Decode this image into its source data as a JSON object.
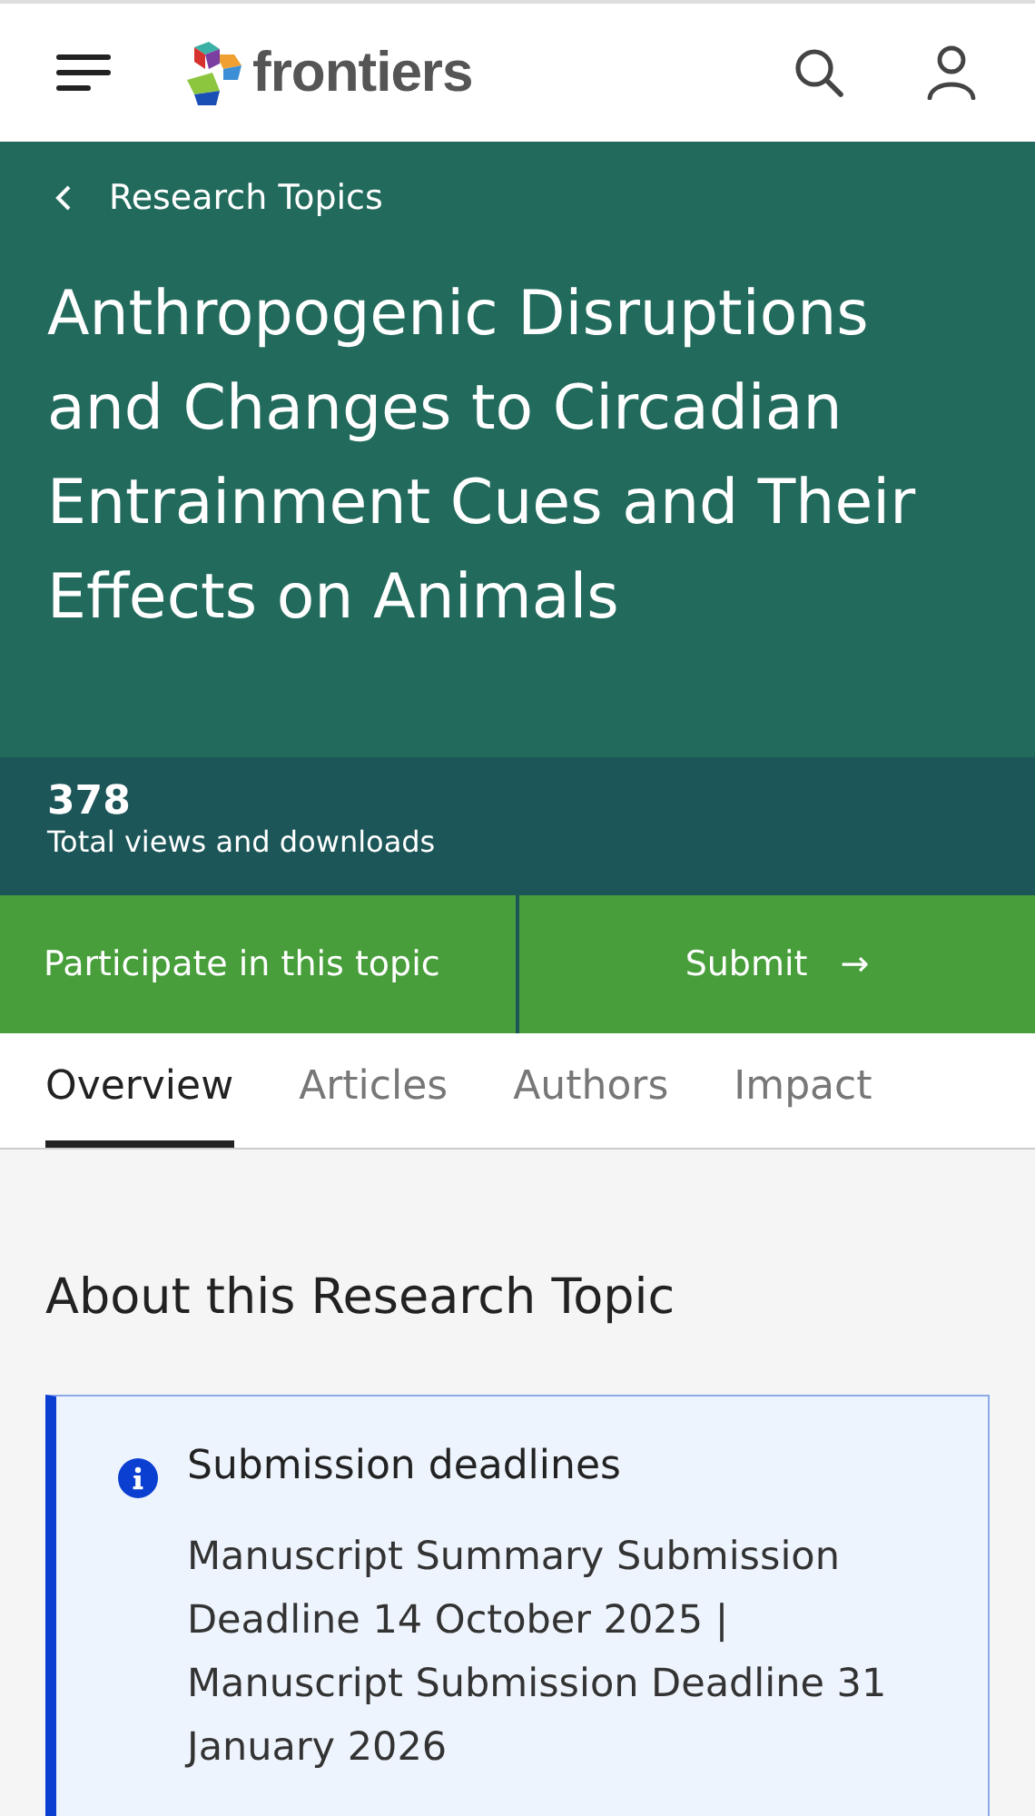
{
  "header": {
    "logo_text": "frontiers"
  },
  "breadcrumb": {
    "label": "Research Topics"
  },
  "title": "Anthropogenic Disruptions and Changes to Circadian Entrainment Cues and Their Effects on Animals",
  "stats": {
    "count": "378",
    "label": "Total views and downloads"
  },
  "actions": {
    "participate": "Participate in this topic",
    "submit": "Submit",
    "submit_arrow": "→"
  },
  "tabs": [
    {
      "label": "Overview",
      "selected": true
    },
    {
      "label": "Articles",
      "selected": false
    },
    {
      "label": "Authors",
      "selected": false
    },
    {
      "label": "Impact",
      "selected": false
    }
  ],
  "section_title": "About this Research Topic",
  "notice": {
    "title": "Submission deadlines",
    "text": "Manuscript Summary Submission Deadline 14 October 2025 | Manuscript Submission Deadline 31 January 2026"
  }
}
